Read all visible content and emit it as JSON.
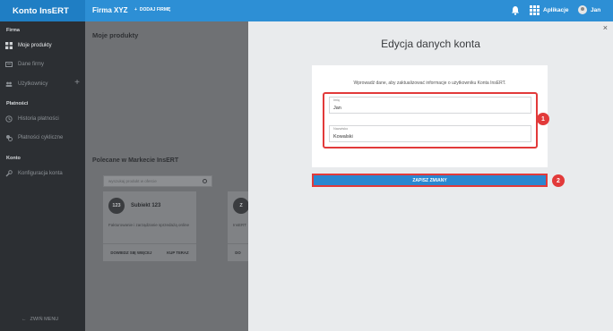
{
  "header": {
    "logo": "Konto InsERT",
    "company": "Firma XYZ",
    "add_company": "DODAJ FIRMĘ",
    "apps_label": "Aplikacje",
    "user_name": "Jan"
  },
  "sidebar": {
    "section_firma": "Firma",
    "item_products": "Moje produkty",
    "item_company_data": "Dane firmy",
    "item_users": "Użytkownicy",
    "section_payments": "Płatności",
    "item_payment_history": "Historia płatności",
    "item_recurring": "Płatności cykliczne",
    "section_account": "Konto",
    "item_account_config": "Konfiguracja konta",
    "collapse_label": "ZWIŃ MENU"
  },
  "main": {
    "title": "Moje produkty",
    "market_title": "Polecane w Markecie InsERT",
    "search_placeholder": "wyszukaj produkt w ofercie",
    "card1": {
      "badge": "123",
      "name": "Subiekt 123",
      "desc": "Fakturowanie i zarządzanie sprzedażą online",
      "btn_more": "DOWIEDZ SIĘ WIĘCEJ",
      "btn_buy": "KUP TERAZ"
    },
    "card2": {
      "badge": "Z",
      "desc": "InsERT",
      "btn": "DO"
    }
  },
  "panel": {
    "close": "×",
    "title": "Edycja danych konta",
    "description": "Wprowadź dane, aby zaktualizować informacje o użytkowniku Konta InsERT.",
    "first_name_label": "Imię",
    "first_name_value": "Jan",
    "last_name_label": "Nazwisko",
    "last_name_value": "Kowalski",
    "save_label": "ZAPISZ ZMIANY",
    "callout1": "1",
    "callout2": "2"
  },
  "colors": {
    "topbar": "#2d8fd5",
    "accent_button": "#2a87d0",
    "highlight": "#e23a3a"
  }
}
